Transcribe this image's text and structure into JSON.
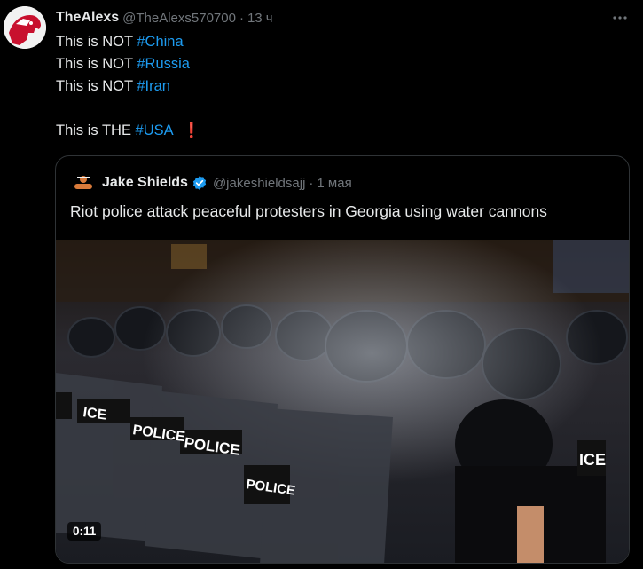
{
  "tweet": {
    "author_name": "TheAlexs",
    "author_handle": "@TheAlexs570700",
    "separator": "·",
    "time": "13 ч",
    "lines": [
      {
        "prefix": "This is NOT ",
        "tag": "#China"
      },
      {
        "prefix": "This is NOT ",
        "tag": "#Russia"
      },
      {
        "prefix": "This is NOT ",
        "tag": "#Iran"
      }
    ],
    "final_line": {
      "prefix": "This is THE ",
      "tag": "#USA",
      "emoji": "❗"
    }
  },
  "quote": {
    "author_name": "Jake Shields",
    "author_handle": "@jakeshieldsajj",
    "separator": "·",
    "time": "1 мая",
    "text": "Riot police attack peaceful protesters in Georgia using water cannons",
    "video_duration": "0:11",
    "shield_labels": [
      "ICE",
      "POLICE",
      "POLICE",
      "POLICE",
      "ICE"
    ]
  },
  "colors": {
    "background": "#000000",
    "text": "#e7e9ea",
    "muted": "#71767b",
    "link": "#1d9bf0",
    "border": "#2f3336",
    "verified": "#1d9bf0"
  },
  "icons": [
    "avatar",
    "more-options-icon",
    "verified-badge-icon"
  ]
}
